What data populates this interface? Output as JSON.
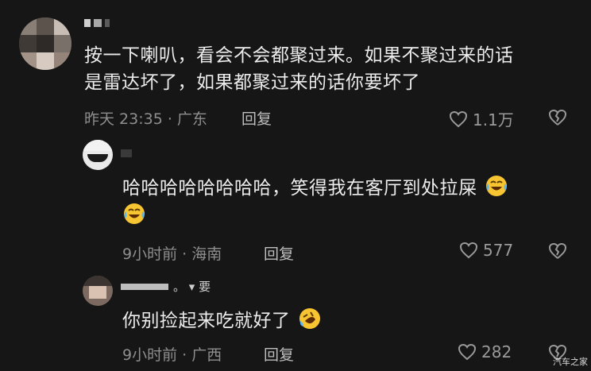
{
  "comments": [
    {
      "text_line1": "按一下喇叭，看会不会都聚过来。如果不聚过来的话",
      "text_line2": "是雷达坏了，如果都聚过来的话你要坏了",
      "meta": "昨天 23:35 · 广东",
      "reply_label": "回复",
      "likes": "1.1万"
    },
    {
      "text_line1": "哈哈哈哈哈哈哈哈，笑得我在客厅到处拉屎",
      "meta": "9小时前 · 海南",
      "reply_label": "回复",
      "likes": "577"
    },
    {
      "text_line1": "你别捡起来吃就好了",
      "meta": "9小时前 · 广西",
      "reply_label": "回复",
      "likes": "282",
      "name_fragment": "。 ▾ 要"
    }
  ],
  "watermark": "汽车之家",
  "colors": {
    "background": "#161616",
    "text": "#ececec",
    "meta": "#8e8e8e"
  }
}
